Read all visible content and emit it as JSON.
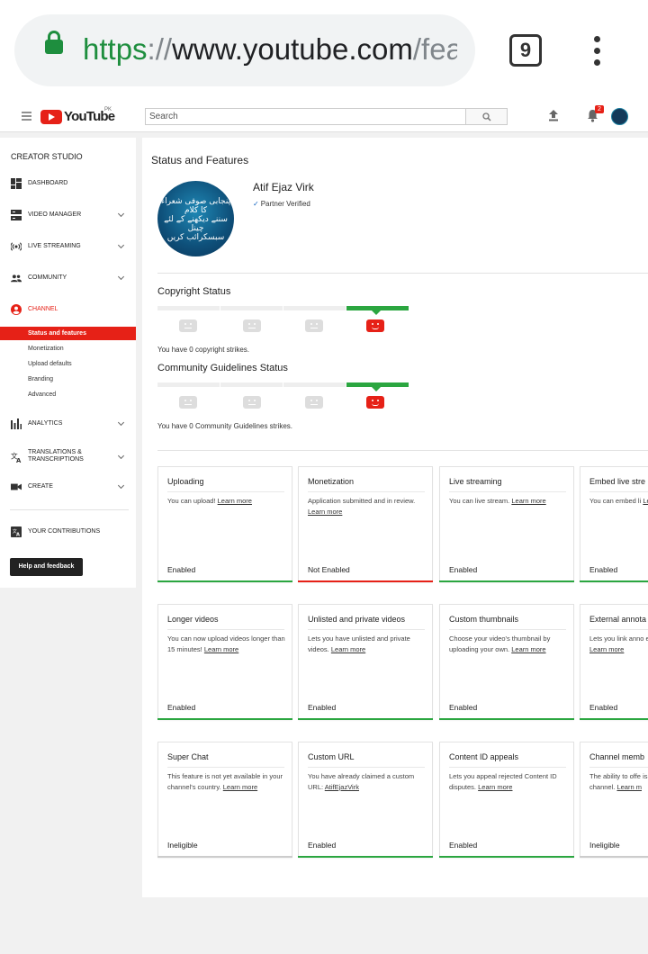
{
  "browser": {
    "url_scheme": "https",
    "url_sep": "://",
    "url_host": "www.youtube.com",
    "url_path": "/fea",
    "tab_count": "9"
  },
  "header": {
    "logo_text": "YouTube",
    "region": "PK",
    "search_placeholder": "Search",
    "notification_count": "2"
  },
  "sidebar": {
    "title": "CREATOR STUDIO",
    "items": [
      {
        "label": "DASHBOARD"
      },
      {
        "label": "VIDEO MANAGER"
      },
      {
        "label": "LIVE STREAMING"
      },
      {
        "label": "COMMUNITY"
      },
      {
        "label": "CHANNEL"
      },
      {
        "label": "ANALYTICS"
      },
      {
        "label": "TRANSLATIONS & TRANSCRIPTIONS"
      },
      {
        "label": "CREATE"
      },
      {
        "label": "YOUR CONTRIBUTIONS"
      }
    ],
    "channel_sub": [
      "Status and features",
      "Monetization",
      "Upload defaults",
      "Branding",
      "Advanced"
    ],
    "help_button": "Help and feedback"
  },
  "main": {
    "title": "Status and Features",
    "channel_name": "Atif Ejaz Virk",
    "verified": "Partner Verified",
    "avatar_text": [
      "پنجابی صوفی شعراء کا کلام",
      "سننے دیکھنے کے لئے چینل",
      "سبسکرائب کریں"
    ],
    "copyright_title": "Copyright Status",
    "copyright_note": "You have 0 copyright strikes.",
    "community_title": "Community Guidelines Status",
    "community_note": "You have 0 Community Guidelines strikes.",
    "features": [
      {
        "title": "Uploading",
        "desc": "You can upload!",
        "link": "Learn more",
        "status": "Enabled",
        "bar": "green"
      },
      {
        "title": "Monetization",
        "desc": "Application submitted and in review.",
        "link": "Learn more",
        "status": "Not Enabled",
        "bar": "red"
      },
      {
        "title": "Live streaming",
        "desc": "You can live stream.",
        "link": "Learn more",
        "status": "Enabled",
        "bar": "green"
      },
      {
        "title": "Embed live stre",
        "desc": "You can embed li",
        "link": "Learn more",
        "status": "Enabled",
        "bar": "green"
      },
      {
        "title": "Longer videos",
        "desc": "You can now upload videos longer than 15 minutes!",
        "link": "Learn more",
        "status": "Enabled",
        "bar": "green"
      },
      {
        "title": "Unlisted and private videos",
        "desc": "Lets you have unlisted and private videos.",
        "link": "Learn more",
        "status": "Enabled",
        "bar": "green"
      },
      {
        "title": "Custom thumbnails",
        "desc": "Choose your video's thumbnail by uploading your own.",
        "link": "Learn more",
        "status": "Enabled",
        "bar": "green"
      },
      {
        "title": "External annota",
        "desc": "Lets you link anno external sites or m",
        "link": "Learn more",
        "status": "Enabled",
        "bar": "green"
      },
      {
        "title": "Super Chat",
        "desc": "This feature is not yet available in your channel's country.",
        "link": "Learn more",
        "status": "Ineligible",
        "bar": "gray"
      },
      {
        "title": "Custom URL",
        "desc": "You have already claimed a custom URL:",
        "link": "AtifEjazVirk",
        "status": "Enabled",
        "bar": "green"
      },
      {
        "title": "Content ID appeals",
        "desc": "Lets you appeal rejected Content ID disputes.",
        "link": "Learn more",
        "status": "Enabled",
        "bar": "green"
      },
      {
        "title": "Channel memb",
        "desc": "The ability to offe isn't yet available channel.",
        "link": "Learn m",
        "status": "Ineligible",
        "bar": "gray"
      }
    ]
  },
  "colors": {
    "accent_red": "#e62117",
    "green": "#2ba640",
    "secure_green": "#1e8e3e"
  }
}
